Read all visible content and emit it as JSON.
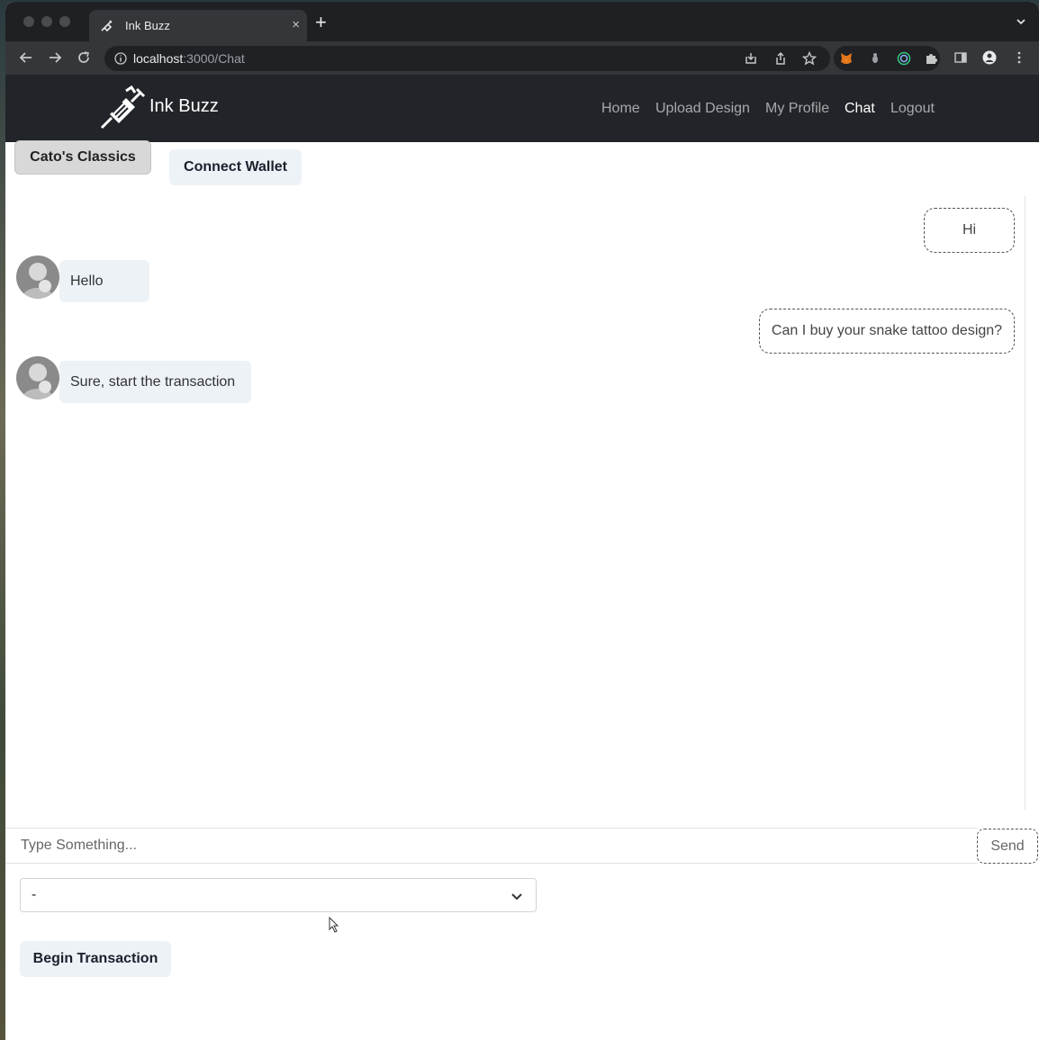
{
  "browser": {
    "tab_title": "Ink Buzz",
    "tab_close": "×",
    "new_tab": "+",
    "url_host": "localhost",
    "url_path": ":3000/Chat"
  },
  "site": {
    "brand": "Ink Buzz",
    "nav": [
      "Home",
      "Upload Design",
      "My Profile",
      "Chat",
      "Logout"
    ],
    "active_nav": "Chat"
  },
  "chat": {
    "channel_button": "Cato's Classics",
    "wallet_button": "Connect Wallet",
    "messages": [
      {
        "side": "right",
        "text": "Hi"
      },
      {
        "side": "left",
        "text": "Hello"
      },
      {
        "side": "right",
        "text": "Can I buy your snake tattoo design?"
      },
      {
        "side": "left",
        "text": "Sure, start the transaction"
      }
    ],
    "input_placeholder": "Type Something...",
    "send_label": "Send",
    "select_value": "-",
    "begin_label": "Begin Transaction"
  },
  "icons": {
    "tab_favicon": "tattoo-machine-icon",
    "brand_logo": "tattoo-machine-icon",
    "info": "info-icon",
    "install": "install-icon",
    "share": "share-icon",
    "bookmark": "star-icon",
    "extensions": [
      "metamask-fox-icon",
      "extension-icon",
      "target-icon",
      "puzzle-icon"
    ]
  }
}
